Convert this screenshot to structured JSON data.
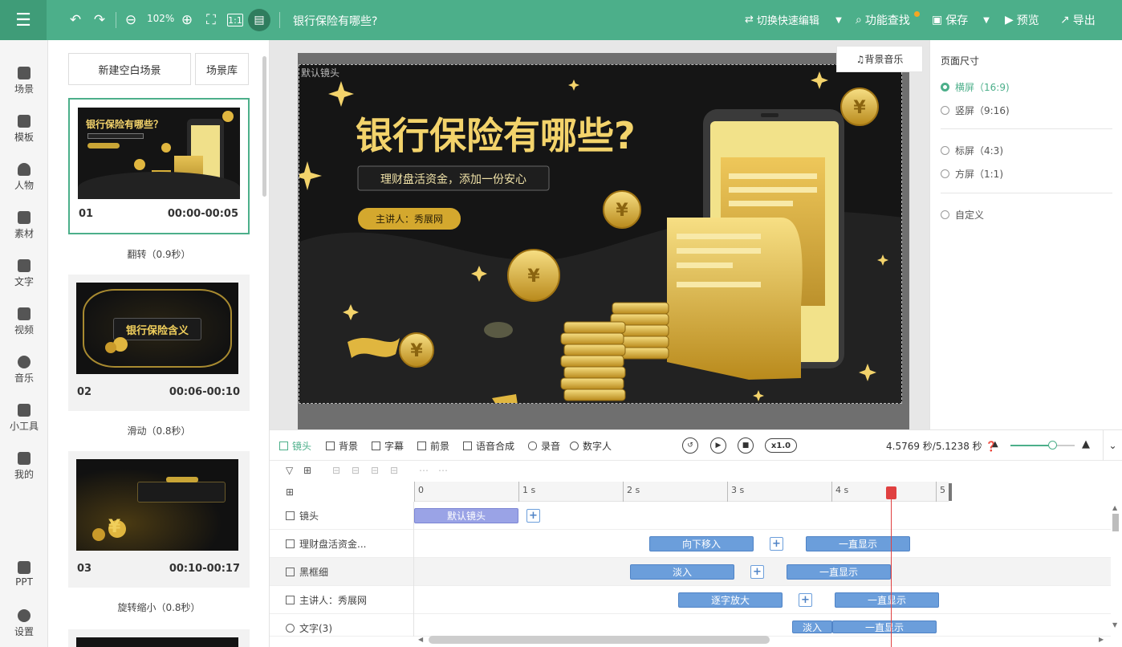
{
  "topbar": {
    "zoom": "102%",
    "title": "银行保险有哪些?",
    "quick_edit": "切换快速编辑",
    "feature_search": "功能查找",
    "save": "保存",
    "preview": "预览",
    "export": "导出"
  },
  "nav": [
    {
      "label": "场景",
      "icon": "scene-icon"
    },
    {
      "label": "模板",
      "icon": "template-icon"
    },
    {
      "label": "人物",
      "icon": "person-icon"
    },
    {
      "label": "素材",
      "icon": "material-icon"
    },
    {
      "label": "文字",
      "icon": "text-icon"
    },
    {
      "label": "视频",
      "icon": "video-icon"
    },
    {
      "label": "音乐",
      "icon": "music-icon"
    },
    {
      "label": "小工具",
      "icon": "toolbox-icon"
    },
    {
      "label": "我的",
      "icon": "upload-icon"
    },
    {
      "label": "PPT",
      "icon": "ppt-icon"
    },
    {
      "label": "设置",
      "icon": "gear-icon"
    }
  ],
  "scenes": {
    "new_blank": "新建空白场景",
    "library": "场景库",
    "items": [
      {
        "num": "01",
        "time": "00:00-00:05",
        "transition": "翻转（0.9秒）",
        "thumb_title": "银行保险有哪些？"
      },
      {
        "num": "02",
        "time": "00:06-00:10",
        "transition": "滑动（0.8秒）",
        "thumb_title": "银行保险含义"
      },
      {
        "num": "03",
        "time": "00:10-00:17",
        "transition": "旋转缩小（0.8秒）",
        "thumb_title": ""
      }
    ]
  },
  "canvas": {
    "bg_music": "背景音乐",
    "lens_label": "默认镜头",
    "headline": "银行保险有哪些?",
    "subtitle": "理财盘活资金，添加一份安心",
    "presenter": "主讲人：秀展网"
  },
  "page_size": {
    "title": "页面尺寸",
    "options": [
      {
        "label": "横屏（16:9)",
        "selected": true
      },
      {
        "label": "竖屏（9:16)",
        "selected": false
      },
      {
        "label": "标屏（4:3)",
        "selected": false
      },
      {
        "label": "方屏（1:1)",
        "selected": false
      },
      {
        "label": "自定义",
        "selected": false
      }
    ]
  },
  "timeline": {
    "tabs": [
      "镜头",
      "背景",
      "字幕",
      "前景",
      "语音合成",
      "录音",
      "数字人"
    ],
    "speed": "x1.0",
    "time_display": "4.5769 秒/5.1238 秒",
    "zoom_level": 0.65,
    "ruler": [
      "0",
      "1 s",
      "2 s",
      "3 s",
      "4 s",
      "5"
    ],
    "tracks": [
      {
        "label": "镜头",
        "clips": [
          "默认镜头"
        ]
      },
      {
        "label": "理财盘活资金...",
        "clips": [
          "向下移入",
          "一直显示"
        ]
      },
      {
        "label": "黑框细",
        "clips": [
          "淡入",
          "一直显示"
        ]
      },
      {
        "label": "主讲人：秀展网",
        "clips": [
          "逐字放大",
          "一直显示"
        ]
      },
      {
        "label": "文字(3)",
        "clips": [
          "淡入",
          "一直显示"
        ]
      }
    ]
  }
}
